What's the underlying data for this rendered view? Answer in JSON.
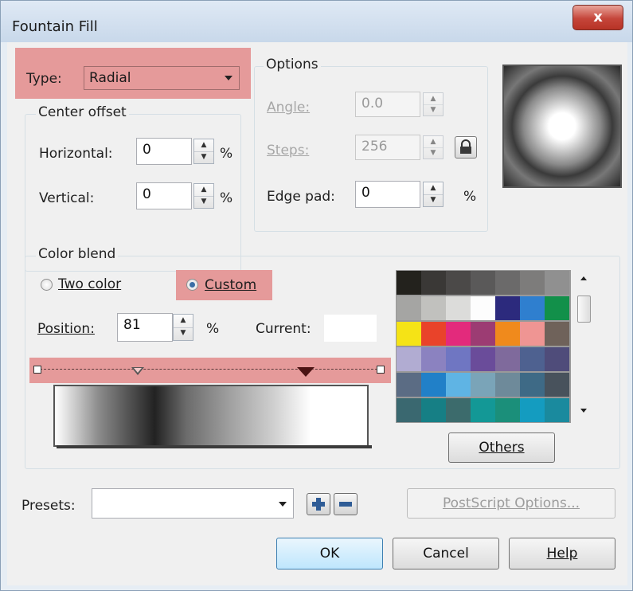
{
  "window": {
    "title": "Fountain Fill",
    "close_glyph": "x"
  },
  "type_row": {
    "label": "Type:",
    "value": "Radial"
  },
  "center_offset": {
    "group_label": "Center offset",
    "horizontal": {
      "label": "Horizontal:",
      "value": "0",
      "unit": "%"
    },
    "vertical": {
      "label": "Vertical:",
      "value": "0",
      "unit": "%"
    }
  },
  "options": {
    "group_label": "Options",
    "angle": {
      "label": "Angle:",
      "value": "0.0"
    },
    "steps": {
      "label": "Steps:",
      "value": "256"
    },
    "edge_pad": {
      "label": "Edge pad:",
      "value": "0",
      "unit": "%"
    }
  },
  "color_blend": {
    "group_label": "Color blend",
    "two_color": {
      "label": "Two color",
      "selected": false
    },
    "custom": {
      "label": "Custom",
      "selected": true
    },
    "position": {
      "label": "Position:",
      "value": "81",
      "unit": "%"
    },
    "current": {
      "label": "Current:"
    },
    "palette_colors": [
      "#23221d",
      "#3a3836",
      "#4b4948",
      "#5a5959",
      "#6b6a6a",
      "#7d7c7b",
      "#909090",
      "#a5a5a3",
      "#c1c1be",
      "#dcdcda",
      "#fdfdfd",
      "#2c2a7d",
      "#2f7fcf",
      "#12904a",
      "#f5e316",
      "#e9432a",
      "#e32a7c",
      "#9c3c73",
      "#f08a1c",
      "#ef9593",
      "#6f625a",
      "#b1acd2",
      "#8b82c0",
      "#6f76c2",
      "#6a4c9a",
      "#7f6a9c",
      "#4e6190",
      "#4f4c7a",
      "#5b6c84",
      "#2180c8",
      "#5fb4e4",
      "#7aa4b8",
      "#6e8a9a",
      "#3e6a86",
      "#48525c",
      "#3a6870",
      "#167f85",
      "#3c6b6c",
      "#139896",
      "#1b8f7a",
      "#149cc0",
      "#1a8a9e"
    ],
    "others_label": "Others"
  },
  "presets": {
    "label": "Presets:",
    "value": "",
    "postscript_label": "PostScript Options..."
  },
  "buttons": {
    "ok": "OK",
    "cancel": "Cancel",
    "help": "Help"
  },
  "icons": {
    "add": "plus-icon",
    "remove": "minus-icon",
    "lock": "lock-icon"
  }
}
